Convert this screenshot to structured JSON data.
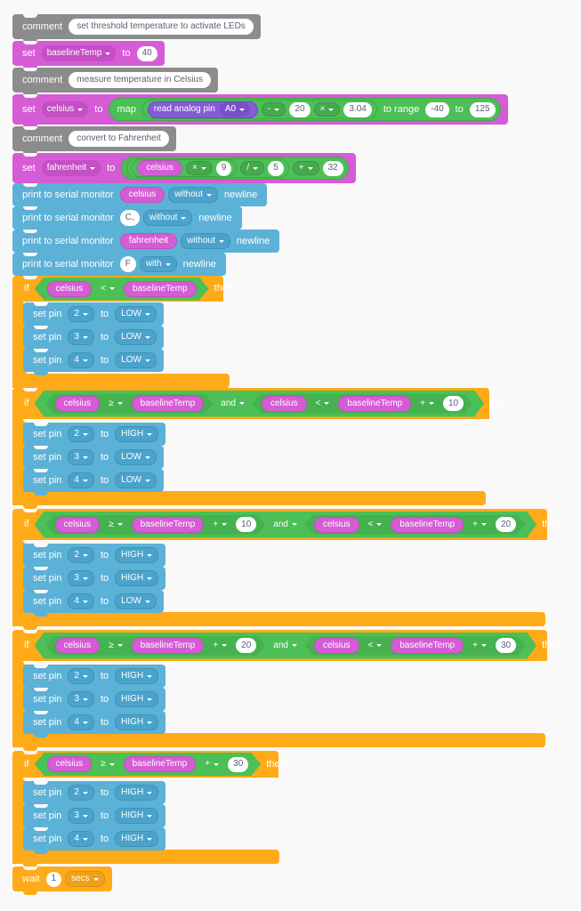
{
  "editor": {
    "name": "block-programming-canvas",
    "background": "#f9f9f9"
  },
  "palette": {
    "comment": "#8c8c8c",
    "variable": "#d65cd6",
    "operator": "#4cbf56",
    "serial": "#5cb1d6",
    "pin": "#5cb1d6",
    "control": "#ffab19",
    "sensing": "#855cd6",
    "field_white": "#ffffff",
    "field_text": "#575e75"
  },
  "labels": {
    "comment": "comment",
    "set": "set",
    "to": "to",
    "map": "map",
    "to_range": "to range",
    "read_analog_pin": "read analog pin",
    "print_to_serial_monitor": "print to serial monitor",
    "newline": "newline",
    "set_pin": "set pin",
    "if": "if",
    "then": "then",
    "wait": "wait"
  },
  "blocks": [
    {
      "id": "comment-1",
      "type": "comment",
      "label": "comment",
      "text": "set threshold temperature to activate LEDs"
    },
    {
      "id": "set-baselinetemp",
      "type": "set-variable",
      "label": "set",
      "variable": "baselineTemp",
      "to": "to",
      "value": "40"
    },
    {
      "id": "comment-2",
      "type": "comment",
      "label": "comment",
      "text": "measure temperature in Celsius"
    },
    {
      "id": "set-celsius",
      "type": "set-variable-map",
      "label": "set",
      "variable": "celsius",
      "to": "to",
      "map": "map",
      "read_analog_pin": "read analog pin",
      "analog_pin": "A0",
      "op1": "-",
      "operand1": "20",
      "op2": "×",
      "operand2": "3.04",
      "to_range": "to range",
      "range_min": "-40",
      "range_to": "to",
      "range_max": "125"
    },
    {
      "id": "comment-3",
      "type": "comment",
      "label": "comment",
      "text": "convert to Fahrenheit"
    },
    {
      "id": "set-fahrenheit",
      "type": "set-variable-expr",
      "label": "set",
      "variable": "fahrenheit",
      "to": "to",
      "term": "celsius",
      "op1": "×",
      "operand1": "9",
      "op2": "/",
      "operand2": "5",
      "op3": "+",
      "operand3": "32"
    },
    {
      "id": "print-celsius",
      "type": "serial-print",
      "label": "print to serial monitor",
      "value": "celsius",
      "value_kind": "variable",
      "mode": "without",
      "newline": "newline"
    },
    {
      "id": "print-c-unit",
      "type": "serial-print",
      "label": "print to serial monitor",
      "value": "C,",
      "value_kind": "text",
      "mode": "without",
      "newline": "newline"
    },
    {
      "id": "print-fahrenheit",
      "type": "serial-print",
      "label": "print to serial monitor",
      "value": "fahrenheit",
      "value_kind": "variable",
      "mode": "without",
      "newline": "newline"
    },
    {
      "id": "print-f-unit",
      "type": "serial-print",
      "label": "print to serial monitor",
      "value": "F",
      "value_kind": "text",
      "mode": "with",
      "newline": "newline"
    }
  ],
  "conditionals": [
    {
      "id": "if-1",
      "label": "if",
      "then": "then",
      "condition": {
        "compound": false,
        "left": "celsius",
        "op": "<",
        "right": "baselineTemp",
        "right_op": null,
        "right_offset": null
      },
      "body": [
        {
          "label": "set pin",
          "pin": "2",
          "to": "to",
          "state": "LOW"
        },
        {
          "label": "set pin",
          "pin": "3",
          "to": "to",
          "state": "LOW"
        },
        {
          "label": "set pin",
          "pin": "4",
          "to": "to",
          "state": "LOW"
        }
      ]
    },
    {
      "id": "if-2",
      "label": "if",
      "then": "then",
      "condition": {
        "compound": true,
        "joiner": "and",
        "a": {
          "left": "celsius",
          "op": "≥",
          "right": "baselineTemp",
          "right_op": null,
          "right_offset": null
        },
        "b": {
          "left": "celsius",
          "op": "<",
          "right": "baselineTemp",
          "right_op": "+",
          "right_offset": "10"
        }
      },
      "body": [
        {
          "label": "set pin",
          "pin": "2",
          "to": "to",
          "state": "HIGH"
        },
        {
          "label": "set pin",
          "pin": "3",
          "to": "to",
          "state": "LOW"
        },
        {
          "label": "set pin",
          "pin": "4",
          "to": "to",
          "state": "LOW"
        }
      ]
    },
    {
      "id": "if-3",
      "label": "if",
      "then": "then",
      "condition": {
        "compound": true,
        "joiner": "and",
        "a": {
          "left": "celsius",
          "op": "≥",
          "right": "baselineTemp",
          "right_op": "+",
          "right_offset": "10"
        },
        "b": {
          "left": "celsius",
          "op": "<",
          "right": "baselineTemp",
          "right_op": "+",
          "right_offset": "20"
        }
      },
      "body": [
        {
          "label": "set pin",
          "pin": "2",
          "to": "to",
          "state": "HIGH"
        },
        {
          "label": "set pin",
          "pin": "3",
          "to": "to",
          "state": "HIGH"
        },
        {
          "label": "set pin",
          "pin": "4",
          "to": "to",
          "state": "LOW"
        }
      ]
    },
    {
      "id": "if-4",
      "label": "if",
      "then": "then",
      "condition": {
        "compound": true,
        "joiner": "and",
        "a": {
          "left": "celsius",
          "op": "≥",
          "right": "baselineTemp",
          "right_op": "+",
          "right_offset": "20"
        },
        "b": {
          "left": "celsius",
          "op": "<",
          "right": "baselineTemp",
          "right_op": "+",
          "right_offset": "30"
        }
      },
      "body": [
        {
          "label": "set pin",
          "pin": "2",
          "to": "to",
          "state": "HIGH"
        },
        {
          "label": "set pin",
          "pin": "3",
          "to": "to",
          "state": "HIGH"
        },
        {
          "label": "set pin",
          "pin": "4",
          "to": "to",
          "state": "HIGH"
        }
      ]
    },
    {
      "id": "if-5",
      "label": "if",
      "then": "then",
      "condition": {
        "compound": false,
        "left": "celsius",
        "op": "≥",
        "right": "baselineTemp",
        "right_op": "+",
        "right_offset": "30"
      },
      "body": [
        {
          "label": "set pin",
          "pin": "2",
          "to": "to",
          "state": "HIGH"
        },
        {
          "label": "set pin",
          "pin": "3",
          "to": "to",
          "state": "HIGH"
        },
        {
          "label": "set pin",
          "pin": "4",
          "to": "to",
          "state": "HIGH"
        }
      ]
    }
  ],
  "wait_block": {
    "label": "wait",
    "value": "1",
    "unit": "secs"
  }
}
